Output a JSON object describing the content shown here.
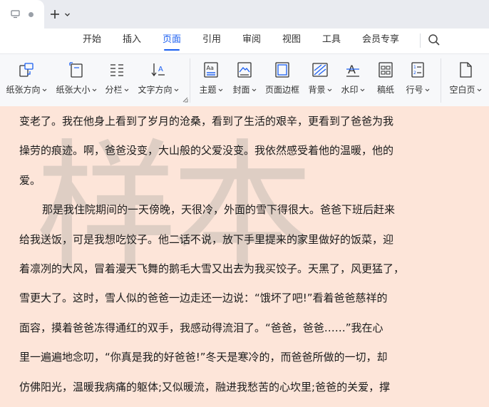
{
  "tabs": {
    "add_label": "+"
  },
  "menu": {
    "items": [
      {
        "label": "开始"
      },
      {
        "label": "插入"
      },
      {
        "label": "页面",
        "active": true
      },
      {
        "label": "引用"
      },
      {
        "label": "审阅"
      },
      {
        "label": "视图"
      },
      {
        "label": "工具"
      },
      {
        "label": "会员专享"
      }
    ],
    "accent_color": "#1a5ef0"
  },
  "toolbar": {
    "tools": [
      {
        "label": "纸张方向",
        "icon": "page-orientation-icon",
        "dropdown": true
      },
      {
        "label": "纸张大小",
        "icon": "page-size-icon",
        "dropdown": true
      },
      {
        "label": "分栏",
        "icon": "columns-icon",
        "dropdown": true
      },
      {
        "label": "文字方向",
        "icon": "text-direction-icon",
        "dropdown": true
      },
      {
        "label": "主题",
        "icon": "theme-icon",
        "dropdown": true
      },
      {
        "label": "封面",
        "icon": "cover-icon",
        "dropdown": true
      },
      {
        "label": "页面边框",
        "icon": "page-border-icon",
        "dropdown": false
      },
      {
        "label": "背景",
        "icon": "background-icon",
        "dropdown": true
      },
      {
        "label": "水印",
        "icon": "watermark-icon",
        "dropdown": true
      },
      {
        "label": "稿纸",
        "icon": "manuscript-paper-icon",
        "dropdown": false
      },
      {
        "label": "行号",
        "icon": "line-number-icon",
        "dropdown": true
      },
      {
        "label": "空白页",
        "icon": "blank-page-icon",
        "dropdown": true
      }
    ]
  },
  "document": {
    "background_color": "#fde5d9",
    "watermark": "样本",
    "lines": [
      {
        "text": "变老了。我在他身上看到了岁月的沧桑，看到了生活的艰辛，更看到了爸爸为我"
      },
      {
        "text": "操劳的痕迹。啊，爸爸没变，大山般的父爱没变。我依然感受着他的温暖，他的"
      },
      {
        "text": "爱。"
      },
      {
        "text": "那是我住院期间的一天傍晚，天很冷，外面的雪下得很大。爸爸下班后赶来",
        "indent": true
      },
      {
        "text": "给我送饭，可是我想吃饺子。他二话不说，放下手里提来的家里做好的饭菜，迎"
      },
      {
        "text": "着凛冽的大风，冒着漫天飞舞的鹅毛大雪又出去为我买饺子。天黑了，风更猛了，"
      },
      {
        "text": "雪更大了。这时，雪人似的爸爸一边走还一边说：“饿坏了吧!”看着爸爸慈祥的"
      },
      {
        "text": "面容，摸着爸爸冻得通红的双手，我感动得流泪了。“爸爸，爸爸……”我在心"
      },
      {
        "text": "里一遍遍地念叨，“你真是我的好爸爸!”冬天是寒冷的，而爸爸所做的一切，却"
      },
      {
        "text": "仿佛阳光，温暖我病痛的躯体;又似暖流，融进我愁苦的心坎里;爸爸的关爱，撑"
      }
    ]
  }
}
